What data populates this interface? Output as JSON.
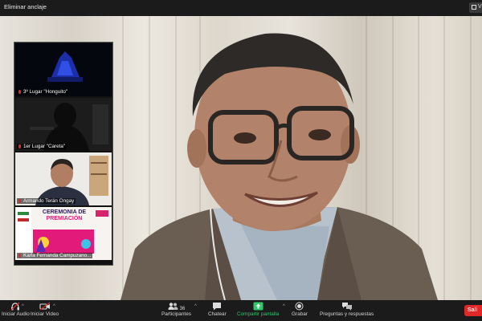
{
  "topbar": {
    "unpin_label": "Eliminar anclaje",
    "view_label": "V"
  },
  "gallery": {
    "tiles": [
      {
        "name": "3º Lugar \"Honguito\""
      },
      {
        "name": "1er Lugar \"Careta\""
      },
      {
        "name": "Armando Terán Ongay"
      },
      {
        "name": "Karla Fernanda Campuzano..."
      }
    ],
    "banner": {
      "line1": "CEREMONIA DE",
      "line2": "PREMIACIÓN"
    }
  },
  "toolbar": {
    "audio_label": "Iniciar Audio",
    "video_label": "Iniciar Video",
    "participants_label": "Participantes",
    "participants_count": "36",
    "chat_label": "Chatear",
    "share_label": "Compartir pantalla",
    "record_label": "Grabar",
    "qa_label": "Preguntas y respuestas",
    "end_label": "Sali"
  },
  "colors": {
    "bar": "#1b1b1b",
    "share_green": "#33c46d",
    "end_red": "#e02828",
    "muted_red": "#e02828"
  }
}
